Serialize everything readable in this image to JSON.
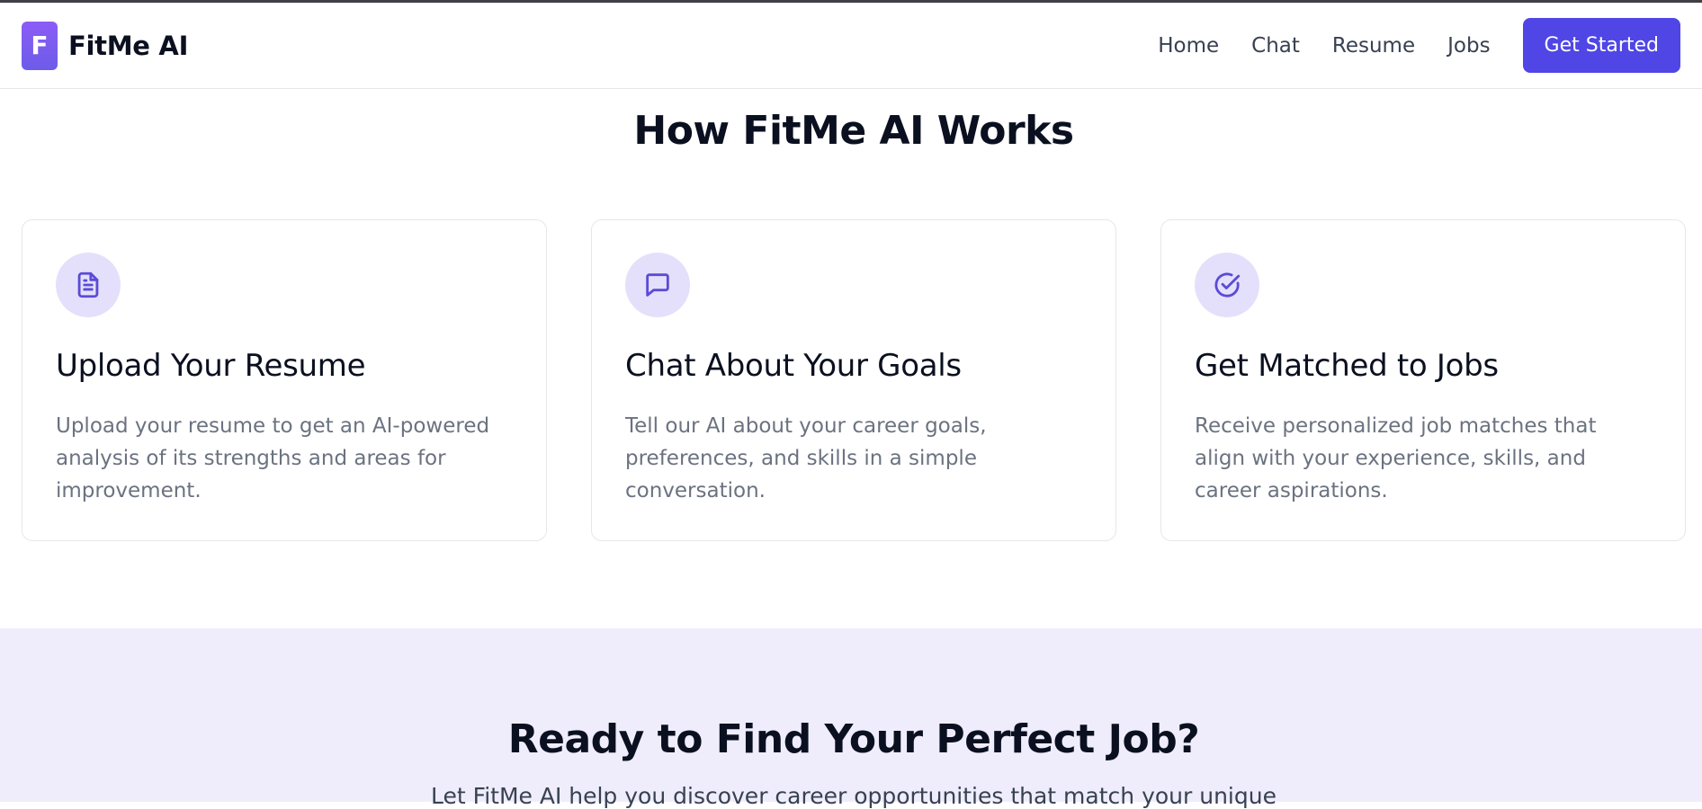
{
  "header": {
    "logo_letter": "F",
    "brand_name": "FitMe AI",
    "nav": [
      "Home",
      "Chat",
      "Resume",
      "Jobs"
    ],
    "cta_label": "Get Started"
  },
  "how_it_works": {
    "title": "How FitMe AI Works",
    "cards": [
      {
        "icon": "document-icon",
        "title": "Upload Your Resume",
        "text": "Upload your resume to get an AI-powered analysis of its strengths and areas for improvement."
      },
      {
        "icon": "chat-bubble-icon",
        "title": "Chat About Your Goals",
        "text": "Tell our AI about your career goals, preferences, and skills in a simple conversation."
      },
      {
        "icon": "check-circle-icon",
        "title": "Get Matched to Jobs",
        "text": "Receive personalized job matches that align with your experience, skills, and career aspirations."
      }
    ]
  },
  "cta_section": {
    "title": "Ready to Find Your Perfect Job?",
    "text": "Let FitMe AI help you discover career opportunities that match your unique"
  },
  "colors": {
    "accent": "#4f46e5",
    "icon_bg": "#e4e0fb",
    "band_bg": "#efedfb"
  }
}
